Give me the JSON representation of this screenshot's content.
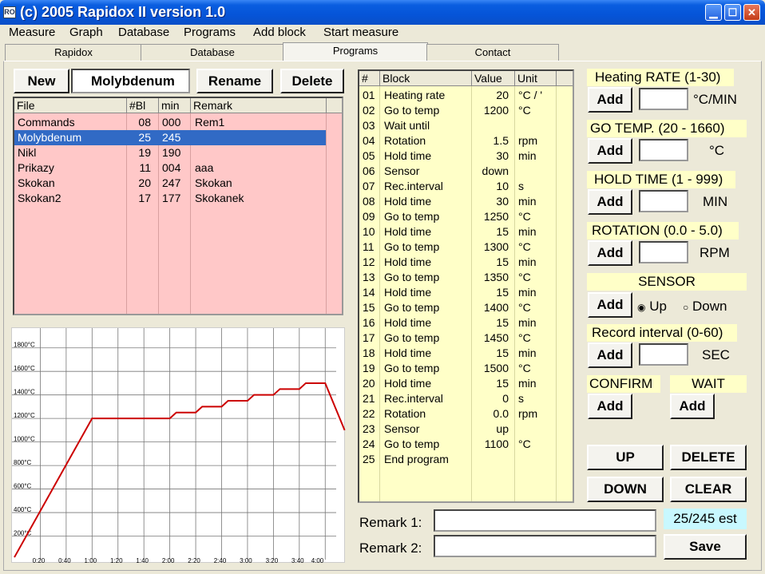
{
  "window": {
    "title": "(c) 2005 Rapidox II version 1.0",
    "icon": "app-icon",
    "app_icon_text": "RO"
  },
  "menu": [
    "Measure",
    "Graph",
    "Database",
    "Programs",
    "Add block",
    "Start measure"
  ],
  "tabs": [
    "Rapidox",
    "Database",
    "Programs",
    "Contact"
  ],
  "active_tab": "Programs",
  "file_panel": {
    "new_label": "New",
    "name_value": "Molybdenum",
    "rename_label": "Rename",
    "delete_label": "Delete",
    "headers": [
      "File",
      "#Bl",
      "min",
      "Remark"
    ],
    "rows": [
      {
        "file": "Commands",
        "bl": "08",
        "min": "000",
        "remark": "Rem1"
      },
      {
        "file": "Molybdenum",
        "bl": "25",
        "min": "245",
        "remark": ""
      },
      {
        "file": "Nikl",
        "bl": "19",
        "min": "190",
        "remark": ""
      },
      {
        "file": "Prikazy",
        "bl": "11",
        "min": "004",
        "remark": "aaa"
      },
      {
        "file": "Skokan",
        "bl": "20",
        "min": "247",
        "remark": "Skokan"
      },
      {
        "file": "Skokan2",
        "bl": "17",
        "min": "177",
        "remark": "Skokanek"
      }
    ],
    "selected_index": 1
  },
  "chart_data": {
    "type": "line",
    "y_ticks": [
      "1800°C",
      "1600°C",
      "1400°C",
      "1200°C",
      "1000°C",
      "800°C",
      "600°C",
      "400°C",
      "200°C"
    ],
    "x_ticks": [
      "0:20",
      "0:40",
      "1:00",
      "1:20",
      "1:40",
      "2:00",
      "2:20",
      "2:40",
      "3:00",
      "3:20",
      "3:40",
      "4:00"
    ],
    "xlim_min": [
      0,
      240
    ],
    "ylim": [
      0,
      1900
    ],
    "grid": true,
    "color": "#cc0000",
    "points": [
      [
        0,
        20
      ],
      [
        60,
        1200
      ],
      [
        120,
        1200
      ],
      [
        125,
        1250
      ],
      [
        140,
        1250
      ],
      [
        145,
        1300
      ],
      [
        160,
        1300
      ],
      [
        165,
        1350
      ],
      [
        180,
        1350
      ],
      [
        185,
        1400
      ],
      [
        200,
        1400
      ],
      [
        205,
        1450
      ],
      [
        220,
        1450
      ],
      [
        225,
        1500
      ],
      [
        240,
        1500
      ],
      [
        255,
        1100
      ]
    ],
    "plot_xmax": 246
  },
  "program_table": {
    "headers": [
      "#",
      "Block",
      "Value",
      "Unit"
    ],
    "rows": [
      [
        "01",
        "Heating rate",
        "20",
        "°C / '"
      ],
      [
        "02",
        "Go to temp",
        "1200",
        "°C"
      ],
      [
        "03",
        "Wait until",
        "",
        ""
      ],
      [
        "04",
        "Rotation",
        "1.5",
        "rpm"
      ],
      [
        "05",
        "Hold time",
        "30",
        "min"
      ],
      [
        "06",
        "Sensor",
        "down",
        ""
      ],
      [
        "07",
        "Rec.interval",
        "10",
        "s"
      ],
      [
        "08",
        "Hold time",
        "30",
        "min"
      ],
      [
        "09",
        "Go to temp",
        "1250",
        "°C"
      ],
      [
        "10",
        "Hold time",
        "15",
        "min"
      ],
      [
        "11",
        "Go to temp",
        "1300",
        "°C"
      ],
      [
        "12",
        "Hold time",
        "15",
        "min"
      ],
      [
        "13",
        "Go to temp",
        "1350",
        "°C"
      ],
      [
        "14",
        "Hold time",
        "15",
        "min"
      ],
      [
        "15",
        "Go to temp",
        "1400",
        "°C"
      ],
      [
        "16",
        "Hold time",
        "15",
        "min"
      ],
      [
        "17",
        "Go to temp",
        "1450",
        "°C"
      ],
      [
        "18",
        "Hold time",
        "15",
        "min"
      ],
      [
        "19",
        "Go to temp",
        "1500",
        "°C"
      ],
      [
        "20",
        "Hold time",
        "15",
        "min"
      ],
      [
        "21",
        "Rec.interval",
        "0",
        "s"
      ],
      [
        "22",
        "Rotation",
        "0.0",
        "rpm"
      ],
      [
        "23",
        "Sensor",
        "up",
        ""
      ],
      [
        "24",
        "Go to temp",
        "1100",
        "°C"
      ],
      [
        "25",
        "End program",
        "",
        ""
      ]
    ]
  },
  "controls": {
    "heating": {
      "label": "Heating RATE (1-30)",
      "unit": "°C/MIN",
      "add": "Add",
      "value": ""
    },
    "gotemp": {
      "label": "GO TEMP. (20 - 1660)",
      "unit": "°C",
      "add": "Add",
      "value": ""
    },
    "hold": {
      "label": "HOLD TIME (1 - 999)",
      "unit": "MIN",
      "add": "Add",
      "value": ""
    },
    "rotation": {
      "label": "ROTATION (0.0 - 5.0)",
      "unit": "RPM",
      "add": "Add",
      "value": ""
    },
    "sensor": {
      "label": "SENSOR",
      "add": "Add",
      "up": "Up",
      "down": "Down",
      "selected": "Up"
    },
    "record": {
      "label": "Record interval (0-60)",
      "unit": "SEC",
      "add": "Add",
      "value": ""
    },
    "confirm": {
      "label": "CONFIRM",
      "add": "Add"
    },
    "wait": {
      "label": "WAIT",
      "add": "Add"
    },
    "up": "UP",
    "delete": "DELETE",
    "down": "DOWN",
    "clear": "CLEAR"
  },
  "remarks": {
    "remark1_label": "Remark 1:",
    "remark1_value": "",
    "remark2_label": "Remark 2:",
    "remark2_value": "",
    "status": "25/245 est",
    "save": "Save"
  },
  "colors": {
    "file_grid": "#ffc8c8",
    "program_grid": "#ffffc8",
    "selected_row": "#316ac5",
    "status_bg": "#c8f8ff"
  }
}
